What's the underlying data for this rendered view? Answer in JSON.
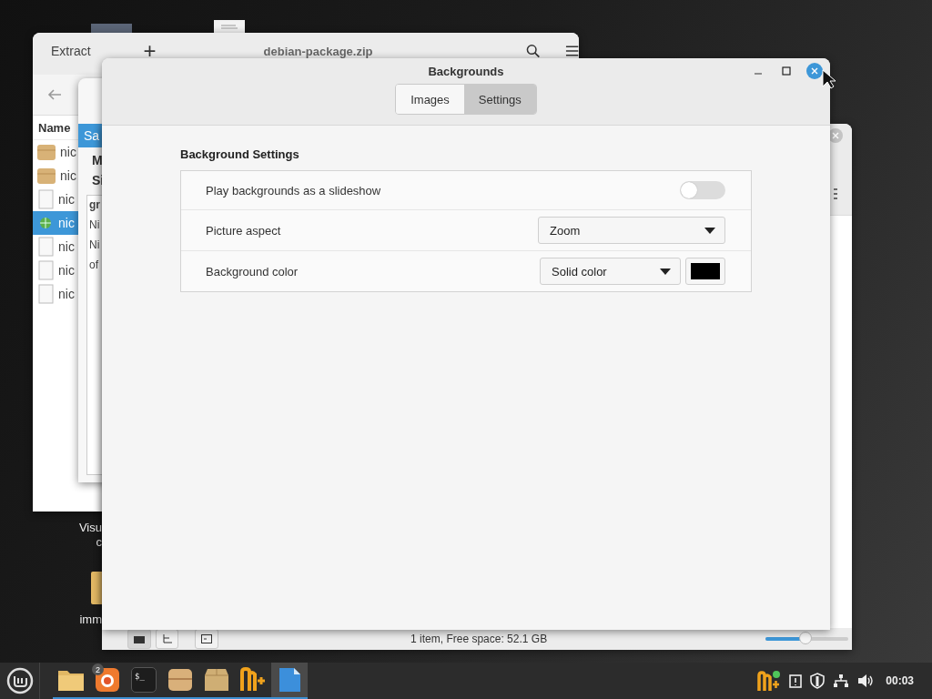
{
  "archive_window": {
    "extract": "Extract",
    "add": "+",
    "title": "debian-package.zip",
    "column": "Name",
    "files": [
      {
        "name": "nic",
        "kind": "package",
        "selected": false
      },
      {
        "name": "nic",
        "kind": "package",
        "selected": false
      },
      {
        "name": "nic",
        "kind": "file",
        "selected": false
      },
      {
        "name": "nic",
        "kind": "web",
        "selected": true
      },
      {
        "name": "nic",
        "kind": "file",
        "selected": false
      },
      {
        "name": "nic",
        "kind": "file",
        "selected": false
      },
      {
        "name": "nic",
        "kind": "file",
        "selected": false
      }
    ]
  },
  "dialog_behind": {
    "header": "Sa",
    "headings": [
      "M",
      "Si"
    ],
    "box_title": "gr",
    "box_lines": [
      "Ni",
      "Ni",
      "of"
    ]
  },
  "file_manager": {
    "status": "1 item, Free space: 52.1 GB",
    "zoom": {
      "level": 0.48
    }
  },
  "desktop_icons": [
    {
      "kind": "app",
      "lines": [
        "Visu",
        "c"
      ]
    },
    {
      "kind": "folder",
      "lines": [
        "imm"
      ]
    }
  ],
  "backgrounds_window": {
    "title": "Backgrounds",
    "tabs": [
      {
        "label": "Images",
        "selected": false
      },
      {
        "label": "Settings",
        "selected": true
      }
    ],
    "section": "Background Settings",
    "rows": [
      {
        "kind": "switch",
        "label": "Play backgrounds as a slideshow",
        "on": false
      },
      {
        "kind": "dropdown",
        "label": "Picture aspect",
        "value": "Zoom"
      },
      {
        "kind": "color",
        "label": "Background color",
        "value": "Solid color"
      }
    ]
  },
  "taskbar": {
    "apps": [
      {
        "kind": "files",
        "running": true,
        "active": false
      },
      {
        "kind": "browser",
        "badge": "2",
        "running": true,
        "active": false
      },
      {
        "kind": "terminal",
        "glyph": "$_",
        "running": true,
        "active": false
      },
      {
        "kind": "box",
        "running": true,
        "active": false
      },
      {
        "kind": "package",
        "running": true,
        "active": false
      },
      {
        "kind": "notes",
        "running": true,
        "active": false
      },
      {
        "kind": "document",
        "running": true,
        "active": true
      }
    ],
    "clock": "00:03"
  }
}
